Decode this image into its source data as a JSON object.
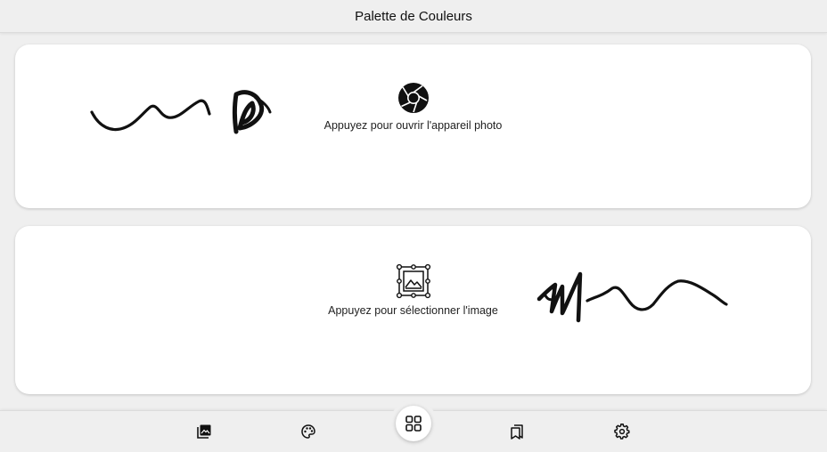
{
  "header": {
    "title": "Palette de Couleurs"
  },
  "camera_card": {
    "label": "Appuyez pour ouvrir l'appareil photo",
    "icon": "camera-aperture-icon"
  },
  "gallery_card": {
    "label": "Appuyez pour sélectionner l'image",
    "icon": "image-select-icon"
  },
  "bottom_nav": {
    "items": [
      {
        "icon": "photo-library-icon"
      },
      {
        "icon": "palette-icon"
      },
      {
        "icon": "grid-icon",
        "active": true
      },
      {
        "icon": "bookmarks-icon"
      },
      {
        "icon": "gear-icon"
      }
    ]
  },
  "colors": {
    "background": "#efefef",
    "card": "#ffffff",
    "icon": "#111111"
  }
}
